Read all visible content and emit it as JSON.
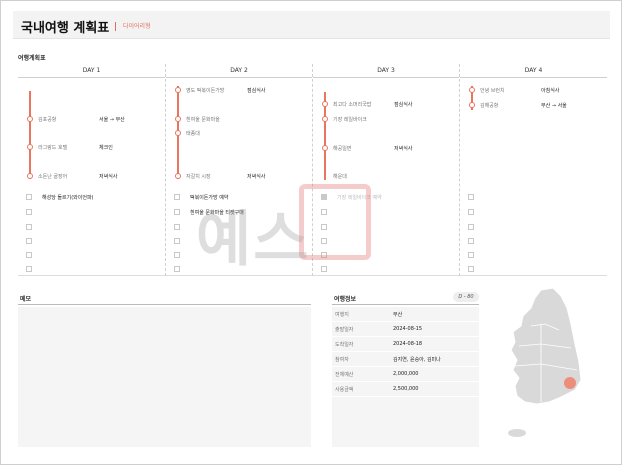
{
  "header": {
    "title": "국내여행 계획표",
    "subtitle": "다이어리형"
  },
  "plan": {
    "section_label": "여행계획표",
    "days": [
      {
        "label": "DAY 1",
        "stops": [
          {
            "place": "김포공항",
            "act": "서울 → 부산"
          },
          {
            "place": "라그랑드 호텔",
            "act": "체크인"
          },
          {
            "place": "소돈난 골장어",
            "act": "저녁식사"
          }
        ],
        "todos": [
          "해성당 돌르기(와이언파)",
          "",
          "",
          "",
          "",
          ""
        ]
      },
      {
        "label": "DAY 2",
        "stops": [
          {
            "place": "영도 떡볶이돈가방",
            "act": "점심식사"
          },
          {
            "place": "흰여울 문화마을",
            "act": ""
          },
          {
            "place": "태종대",
            "act": ""
          },
          {
            "place": "자갈치 시장",
            "act": "저녁식사"
          }
        ],
        "todos": [
          "떡볶이돈가방 예약",
          "흰여울 문화마을 티켓구매",
          "",
          "",
          "",
          ""
        ]
      },
      {
        "label": "DAY 3",
        "stops": [
          {
            "place": "최고다 소머리국밥",
            "act": "점심식사"
          },
          {
            "place": "기장 레일바이크",
            "act": ""
          },
          {
            "place": "해공일면",
            "act": "저녁식사"
          },
          {
            "place": "해운대",
            "act": ""
          }
        ],
        "todos": [
          "기장 레일바이크 예약",
          "",
          "",
          "",
          "",
          ""
        ]
      },
      {
        "label": "DAY 4",
        "stops": [
          {
            "place": "안녕 브런치",
            "act": "아침식사"
          },
          {
            "place": "김해공항",
            "act": "부산 → 서울"
          }
        ],
        "todos": [
          "",
          "",
          "",
          "",
          "",
          ""
        ]
      }
    ]
  },
  "memo": {
    "label": "메모"
  },
  "info": {
    "label": "여행정보",
    "dday": "D - 80",
    "rows": [
      {
        "label": "여행지",
        "value": "부산"
      },
      {
        "label": "출발일자",
        "value": "2024-08-15"
      },
      {
        "label": "도착일자",
        "value": "2024-08-18"
      },
      {
        "label": "참여자",
        "value": "김지연, 윤승아, 김미나"
      },
      {
        "label": "전체예산",
        "value": "2,000,000"
      },
      {
        "label": "사용금액",
        "value": "2,500,000"
      }
    ]
  },
  "colors": {
    "accent": "#e8755e",
    "watermark": "#a0a0a0"
  },
  "watermark": {
    "text": "예스"
  }
}
